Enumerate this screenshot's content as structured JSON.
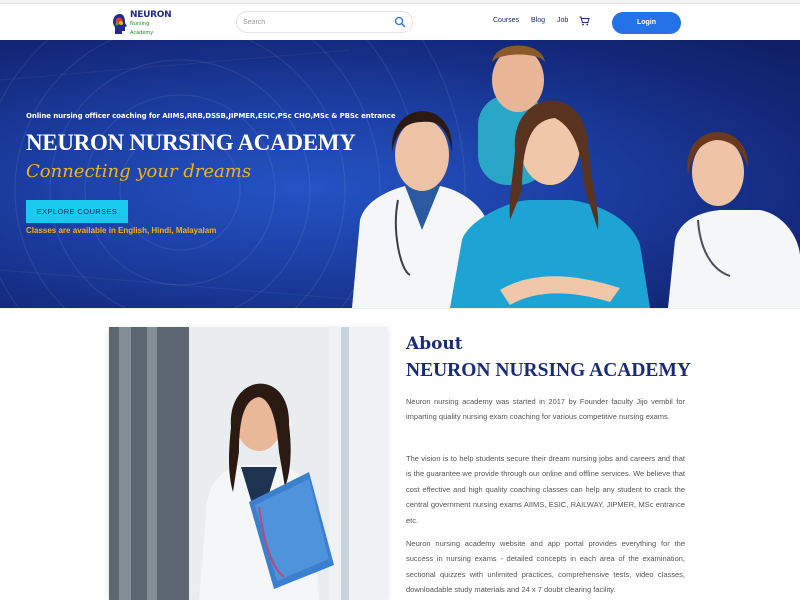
{
  "header": {
    "logo": {
      "title": "NEURON",
      "subtitle": "Nursing Academy"
    },
    "search": {
      "placeholder": "Search",
      "icon": "search-icon"
    },
    "nav": {
      "courses": "Courses",
      "blog": "Blog",
      "job": "Job",
      "cart_icon": "cart-icon"
    },
    "login_label": "Login"
  },
  "hero": {
    "tagline": "Online nursing officer coaching for AIIMS,RRB,DSSB,JIPMER,ESIC,PSc CHO,MSc & PBSc entrance",
    "title": "NEURON NURSING ACADEMY",
    "subtitle": "Connecting your dreams",
    "cta_label": "EXPLORE COURSES",
    "languages": "Classes are available in English, Hindi, Malayalam"
  },
  "about": {
    "heading": "About",
    "subheading": "NEURON NURSING ACADEMY",
    "paragraphs": [
      "Neuron nursing academy was started in 2017 by Founder faculty Jijo vembil for imparting quality nursing exam coaching for various competitive nursing exams.",
      "The vision is to help students secure their dream nursing jobs and careers and that is the guarantee we provide through our online and offline services. We believe that cost effective and high quality coaching classes can help any student to crack the central government nursing exams AIIMS, ESIC, RAILWAY, JIPMER, MSc entrance etc.",
      "Neuron nursing academy website and app portal provides everything for the success in nursing exams - detailed concepts in each area of the examination, sectional quizzes with unlimited practices, comprehensive tests, video classes, downloadable study materials and 24 x 7 doubt clearing facility."
    ]
  },
  "colors": {
    "primary_blue": "#1a2b78",
    "login_blue": "#2471e8",
    "accent_yellow": "#f2b21b",
    "cta_cyan": "#19c9ee"
  }
}
